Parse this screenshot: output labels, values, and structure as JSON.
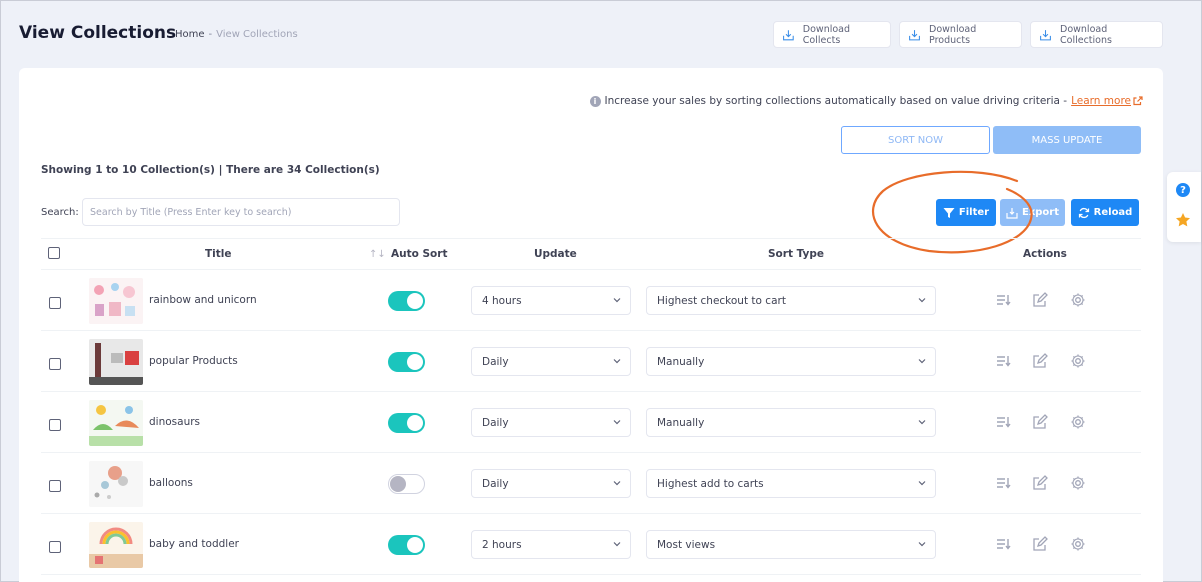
{
  "header": {
    "title": "View Collections",
    "breadcrumb": {
      "home": "Home",
      "separator": "-",
      "current": "View Collections"
    },
    "downloads": [
      {
        "label": "Download Collects",
        "icon": "download-icon"
      },
      {
        "label": "Download Products",
        "icon": "download-icon"
      },
      {
        "label": "Download Collections",
        "icon": "download-icon"
      }
    ]
  },
  "info": {
    "icon": "info-icon",
    "text": "Increase your sales by sorting collections automatically based on value driving criteria -",
    "link": "Learn more",
    "link_icon": "external-link-icon"
  },
  "actions": {
    "sort_now": "SORT NOW",
    "mass_update": "MASS UPDATE"
  },
  "summary": "Showing 1 to 10 Collection(s) | There are 34 Collection(s)",
  "search": {
    "label": "Search:",
    "placeholder": "Search by Title (Press Enter key to search)",
    "value": ""
  },
  "toolbar": {
    "filter": "Filter",
    "export": "Export",
    "reload": "Reload"
  },
  "table": {
    "columns": [
      "Title",
      "Auto Sort",
      "Update",
      "Sort Type",
      "Actions"
    ],
    "sort_indicator": "↑↓",
    "rows": [
      {
        "title": "rainbow and unicorn",
        "auto_sort": true,
        "update": "4 hours",
        "sort_type": "Highest checkout to cart"
      },
      {
        "title": "popular Products",
        "auto_sort": true,
        "update": "Daily",
        "sort_type": "Manually"
      },
      {
        "title": "dinosaurs",
        "auto_sort": true,
        "update": "Daily",
        "sort_type": "Manually"
      },
      {
        "title": "balloons",
        "auto_sort": false,
        "update": "Daily",
        "sort_type": "Highest add to carts"
      },
      {
        "title": "baby and toddler",
        "auto_sort": true,
        "update": "2 hours",
        "sort_type": "Most views"
      }
    ]
  },
  "colors": {
    "primary": "#1e88f5",
    "primary_light": "#8fbdf7",
    "toggle_on": "#1bc5bd",
    "accent": "#e86c2a"
  },
  "side_widget": {
    "icons": [
      "help-icon",
      "star-icon"
    ]
  }
}
